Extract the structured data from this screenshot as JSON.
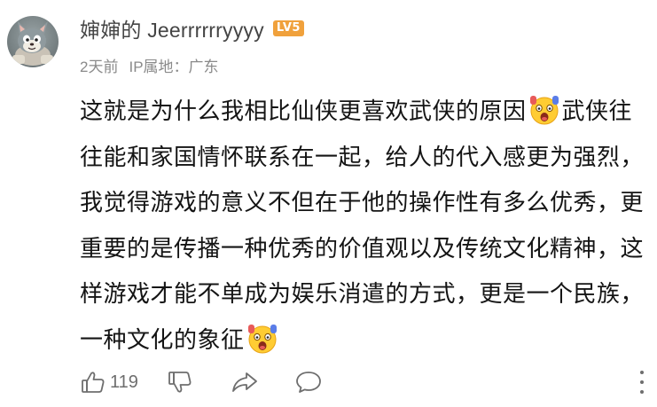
{
  "comment": {
    "username": "婶婶的 Jeerrrrrryyyy",
    "level_badge": "LV5",
    "time": "2天前",
    "ip_location": "IP属地：广东",
    "text_part1": "这就是为什么我相比仙侠更喜欢武侠的原因",
    "text_part2": "武侠往往能和家国情怀联系在一起，给人的代入感更为强烈，我觉得游戏的意义不但在于他的操作性有多么优秀，更重要的是传播一种优秀的价值观以及传统文化精神，这样游戏才能不单成为娱乐消遣的方式，更是一个民族，一种文化的象征",
    "emoji_name": "shocked-scream-emoji",
    "like_count": "119"
  },
  "icons": {
    "like": "thumbs-up-icon",
    "dislike": "thumbs-down-icon",
    "share": "share-arrow-icon",
    "reply": "speech-bubble-icon",
    "more": "more-vertical-icon"
  },
  "colors": {
    "level_badge": "#f0a13c",
    "text": "#141414",
    "meta": "#8a8a8a",
    "action": "#6e6e6e"
  }
}
